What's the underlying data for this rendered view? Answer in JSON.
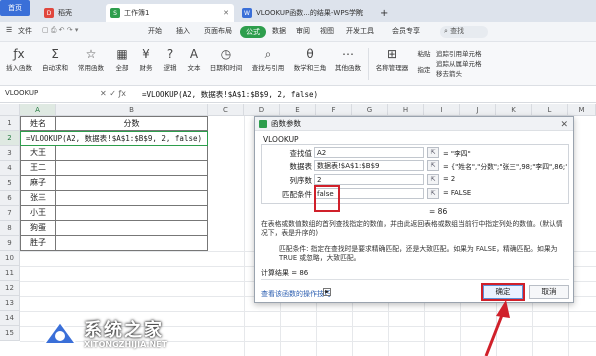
{
  "tabs": {
    "home": "首页",
    "tab1": "稻壳",
    "tab2": "工作簿1",
    "tab3": "VLOOKUP函数...的结果-WPS学院",
    "new": "+"
  },
  "menu": {
    "file": "文件",
    "items": [
      "开始",
      "插入",
      "页面布局",
      "公式",
      "数据",
      "审阅",
      "视图",
      "开发工具",
      "会员专享"
    ],
    "search": "查找"
  },
  "ribbon": {
    "items": [
      "插入函数",
      "自动求和",
      "常用函数",
      "全部",
      "财务",
      "逻辑",
      "文本",
      "日期和时间",
      "查找与引用",
      "数学和三角",
      "其他函数"
    ],
    "right_items": [
      "名称管理器",
      "粘贴",
      "指定",
      "追踪引用单元格",
      "追踪从属单元格",
      "移去箭头"
    ]
  },
  "formula_bar": {
    "name_box": "VLOOKUP",
    "content": "=VLOOKUP(A2, 数据表!$A$1:$B$9, 2, false)"
  },
  "grid": {
    "columns": [
      "A",
      "B",
      "C",
      "D",
      "E",
      "F",
      "G",
      "H",
      "I",
      "J",
      "K",
      "L",
      "M",
      "N"
    ],
    "rows": [
      "1",
      "2",
      "3",
      "4",
      "5",
      "6",
      "7",
      "8",
      "9",
      "10",
      "11",
      "12",
      "13",
      "14",
      "15"
    ],
    "header_A": "姓名",
    "header_B": "分数",
    "formula_cell": "=VLOOKUP(A2, 数据表!$A$1:$B$9, 2, false)",
    "names": [
      "大王",
      "王二",
      "麻子",
      "张三",
      "小王",
      "狗蛋",
      "胜子"
    ]
  },
  "dialog": {
    "title": "函数参数",
    "function": "VLOOKUP",
    "args": [
      {
        "label": "查找值",
        "value": "A2",
        "result": "= \"李四\""
      },
      {
        "label": "数据表",
        "value": "数据表!$A$1:$B$9",
        "result": "= {\"姓名\",\"分数\";\"张三\",98;\"李四\",86;\"王二..."
      },
      {
        "label": "列序数",
        "value": "2",
        "result": "= 2"
      },
      {
        "label": "匹配条件",
        "value": "false",
        "result": "= FALSE"
      }
    ],
    "total_result": "= 86",
    "description": "在表格或数值数组的首列查找指定的数值，并由此返回表格或数组当前行中指定列处的数值。(默认情况下，表是升序的)",
    "arg_description": "匹配条件:  指定在查找时是要求精确匹配，还是大致匹配。如果为 FALSE，精确匹配。如果为 TRUE 或忽略，大致匹配。",
    "calc_result": "计算结果 = 86",
    "help_link": "查看该函数的操作技巧",
    "ok": "确定",
    "cancel": "取消"
  },
  "watermark": {
    "title": "系统之家",
    "subtitle": "XITONGZHIJIA.NET"
  }
}
